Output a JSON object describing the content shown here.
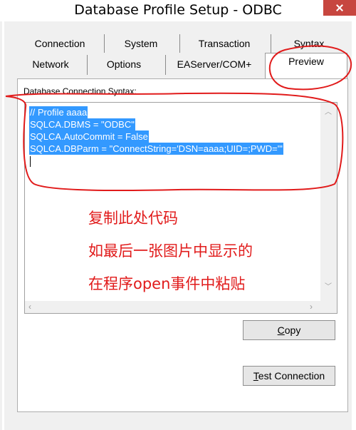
{
  "window": {
    "title": "Database Profile Setup - ODBC"
  },
  "tabs": {
    "row1": [
      "Connection",
      "System",
      "Transaction",
      "Syntax"
    ],
    "row2": [
      "Network",
      "Options",
      "EAServer/COM+",
      "Preview"
    ],
    "active": "Preview"
  },
  "preview": {
    "syntax_label": "Database Connection Syntax:",
    "code": [
      "// Profile aaaa",
      "SQLCA.DBMS = \"ODBC\"",
      "SQLCA.AutoCommit = False",
      "SQLCA.DBParm = \"ConnectString='DSN=aaaa;UID=;PWD='\""
    ]
  },
  "buttons": {
    "copy_prefix": "",
    "copy_accel": "C",
    "copy_rest": "opy",
    "test_prefix": "",
    "test_accel": "T",
    "test_rest": "est Connection"
  },
  "annotation": {
    "color": "#e11b1b",
    "lines": [
      "复制此处代码",
      "如最后一张图片中显示的",
      "在程序open事件中粘贴"
    ]
  },
  "colors": {
    "selection": "#3399ff",
    "close": "#c7463f"
  }
}
